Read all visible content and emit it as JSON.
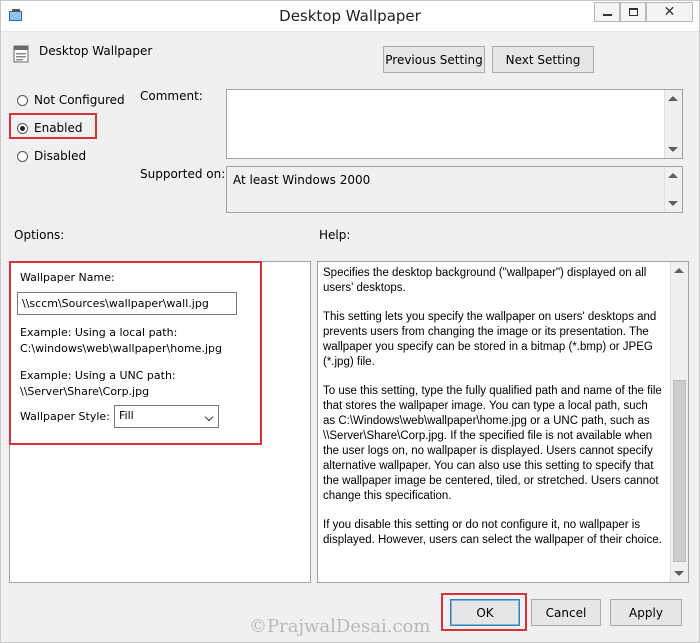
{
  "window": {
    "title": "Desktop Wallpaper",
    "policy_name": "Desktop Wallpaper"
  },
  "nav": {
    "previous_label": "Previous Setting",
    "next_label": "Next Setting"
  },
  "state": {
    "options": [
      {
        "label": "Not Configured",
        "selected": false
      },
      {
        "label": "Enabled",
        "selected": true
      },
      {
        "label": "Disabled",
        "selected": false
      }
    ]
  },
  "comment": {
    "label": "Comment:",
    "value": ""
  },
  "supported": {
    "label": "Supported on:",
    "value": "At least Windows 2000"
  },
  "sections": {
    "options_label": "Options:",
    "help_label": "Help:"
  },
  "options_panel": {
    "name_label": "Wallpaper Name:",
    "name_value": "\\\\sccm\\Sources\\wallpaper\\wall.jpg",
    "local_example_title": "Example: Using a local path:",
    "local_example_path": "C:\\windows\\web\\wallpaper\\home.jpg",
    "unc_example_title": "Example: Using a UNC path:",
    "unc_example_path": "\\\\Server\\Share\\Corp.jpg",
    "style_label": "Wallpaper Style:",
    "style_value": "Fill"
  },
  "help": {
    "paragraphs": [
      "Specifies the desktop background (\"wallpaper\") displayed on all users' desktops.",
      "This setting lets you specify the wallpaper on users' desktops and prevents users from changing the image or its presentation. The wallpaper you specify can be stored in a bitmap (*.bmp) or JPEG (*.jpg) file.",
      "To use this setting, type the fully qualified path and name of the file that stores the wallpaper image. You can type a local path, such as C:\\Windows\\web\\wallpaper\\home.jpg or a UNC path, such as \\\\Server\\Share\\Corp.jpg. If the specified file is not available when the user logs on, no wallpaper is displayed. Users cannot specify alternative wallpaper. You can also use this setting to specify that the wallpaper image be centered, tiled, or stretched. Users cannot change this specification.",
      "If you disable this setting or do not configure it, no wallpaper is displayed. However, users can select the wallpaper of their choice."
    ]
  },
  "footer": {
    "ok_label": "OK",
    "cancel_label": "Cancel",
    "apply_label": "Apply"
  },
  "watermark": "©PrajwalDesai.com",
  "colors": {
    "highlight": "#d9303a",
    "window_bg": "#f0f0f0"
  }
}
